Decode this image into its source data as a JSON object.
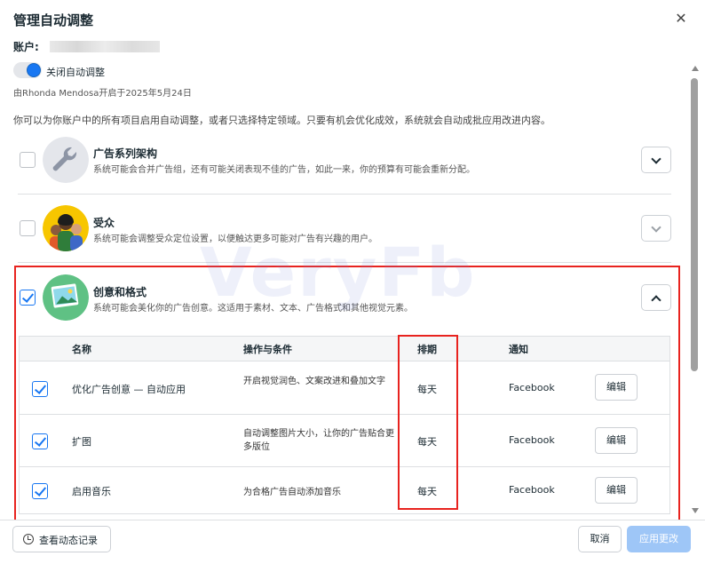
{
  "dialog": {
    "title": "管理自动调整",
    "close_glyph": "✕"
  },
  "account": {
    "label": "账户:"
  },
  "toggle": {
    "label": "关闭自动调整",
    "on": true
  },
  "enabled_by": "由Rhonda Mendosa开启于2025年5月24日",
  "intro": "你可以为你账户中的所有项目启用自动调整，或者只选择特定领域。只要有机会优化成效，系统就会自动成批应用改进内容。",
  "sections": [
    {
      "title": "广告系列架构",
      "desc": "系统可能会合并广告组，还有可能关闭表现不佳的广告，如此一来，你的预算有可能会重新分配。",
      "checked": false,
      "expanded": false
    },
    {
      "title": "受众",
      "desc": "系统可能会调整受众定位设置，以便触达更多可能对广告有兴趣的用户。",
      "checked": false,
      "expanded": false
    },
    {
      "title": "创意和格式",
      "desc": "系统可能会美化你的广告创意。这适用于素材、文本、广告格式和其他视觉元素。",
      "checked": true,
      "expanded": true
    }
  ],
  "table": {
    "headers": [
      "名称",
      "操作与条件",
      "排期",
      "通知"
    ],
    "rows": [
      {
        "name": "优化广告创意 — 自动应用",
        "action": "开启视觉润色、文案改进和叠加文字",
        "schedule": "每天",
        "notify": "Facebook",
        "edit": "编辑",
        "checked": true
      },
      {
        "name": "扩图",
        "action": "自动调整图片大小，让你的广告贴合更多版位",
        "schedule": "每天",
        "notify": "Facebook",
        "edit": "编辑",
        "checked": true
      },
      {
        "name": "启用音乐",
        "action": "为合格广告自动添加音乐",
        "schedule": "每天",
        "notify": "Facebook",
        "edit": "编辑",
        "checked": true
      }
    ]
  },
  "footer": {
    "history": "查看动态记录",
    "cancel": "取消",
    "apply": "应用更改"
  },
  "watermark": "VeryFb",
  "colors": {
    "accent": "#1877f2",
    "highlight": "#e8231f",
    "apply_disabled": "#9ec6f7"
  },
  "icons": [
    "close-icon",
    "chevron-down-icon",
    "chevron-up-icon",
    "wrench-icon",
    "people-icon",
    "image-icon",
    "clock-icon",
    "checkmark-icon"
  ]
}
